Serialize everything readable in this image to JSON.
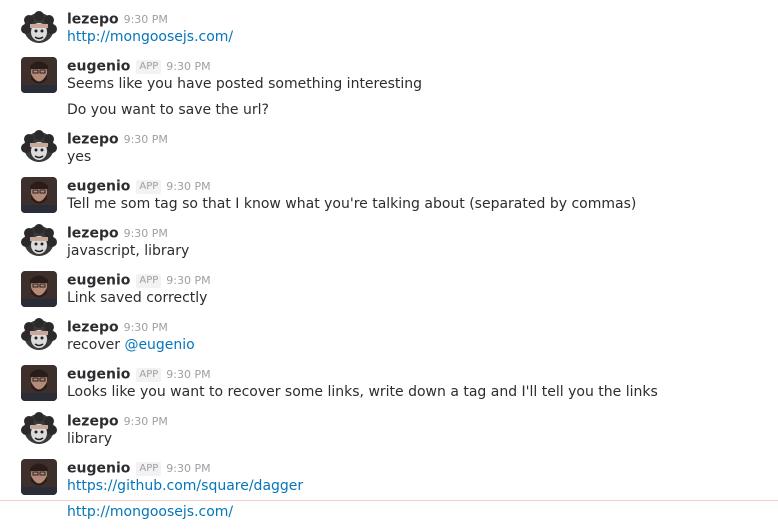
{
  "users": {
    "lezepo": {
      "name": "lezepo",
      "avatar_icon": "afro-face-avatar-icon"
    },
    "eugenio": {
      "name": "eugenio",
      "badge": "APP",
      "avatar_icon": "bearded-man-avatar-icon"
    }
  },
  "messages": [
    {
      "author": "lezepo",
      "time": "9:30 PM",
      "lines": [
        {
          "link": "http://mongoosejs.com/"
        }
      ]
    },
    {
      "author": "eugenio",
      "time": "9:30 PM",
      "lines": [
        {
          "text": "Seems like you have posted something interesting"
        },
        {
          "text": "Do you want to save the url?"
        }
      ]
    },
    {
      "author": "lezepo",
      "time": "9:30 PM",
      "lines": [
        {
          "text": "yes"
        }
      ]
    },
    {
      "author": "eugenio",
      "time": "9:30 PM",
      "lines": [
        {
          "text": "Tell me som tag so that I know what you're talking about (separated by commas)"
        }
      ]
    },
    {
      "author": "lezepo",
      "time": "9:30 PM",
      "lines": [
        {
          "text": "javascript, library"
        }
      ]
    },
    {
      "author": "eugenio",
      "time": "9:30 PM",
      "lines": [
        {
          "text": "Link saved correctly"
        }
      ]
    },
    {
      "author": "lezepo",
      "time": "9:30 PM",
      "lines": [
        {
          "text": "recover ",
          "mention": "@eugenio"
        }
      ]
    },
    {
      "author": "eugenio",
      "time": "9:30 PM",
      "lines": [
        {
          "text": "Looks like you want to recover some links, write down a tag and I'll tell you the links"
        }
      ]
    },
    {
      "author": "lezepo",
      "time": "9:30 PM",
      "lines": [
        {
          "text": "library"
        }
      ]
    },
    {
      "author": "eugenio",
      "time": "9:30 PM",
      "lines": [
        {
          "link": "https://github.com/square/dagger"
        },
        {
          "link": "http://mongoosejs.com/"
        }
      ]
    }
  ],
  "colors": {
    "link": "#0576b9",
    "meta": "#9e9ea6",
    "text": "#2c2d30",
    "divider": "#f6d0c8"
  }
}
